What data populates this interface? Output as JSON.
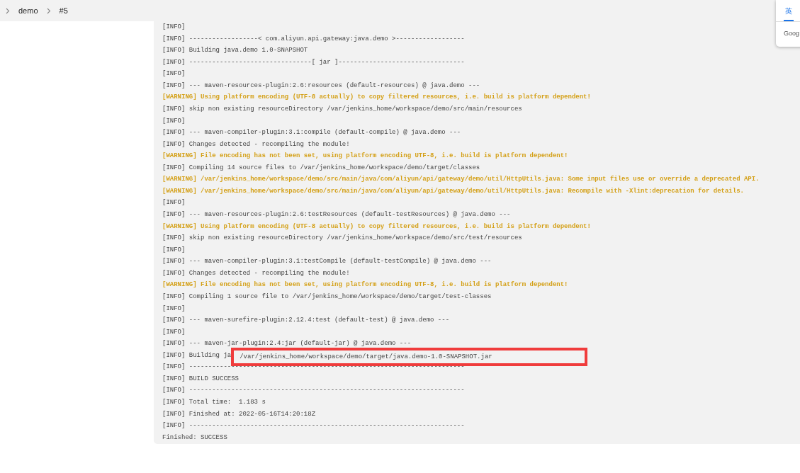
{
  "breadcrumb": [
    {
      "label": "demo"
    },
    {
      "label": "#5"
    }
  ],
  "console": {
    "lines": [
      {
        "kind": "info",
        "text": "[INFO]"
      },
      {
        "kind": "info",
        "text": "[INFO] ------------------< com.aliyun.api.gateway:java.demo >------------------"
      },
      {
        "kind": "info",
        "text": "[INFO] Building java.demo 1.0-SNAPSHOT"
      },
      {
        "kind": "info",
        "text": "[INFO] --------------------------------[ jar ]---------------------------------"
      },
      {
        "kind": "info",
        "text": "[INFO]"
      },
      {
        "kind": "info",
        "text": "[INFO] --- maven-resources-plugin:2.6:resources (default-resources) @ java.demo ---"
      },
      {
        "kind": "warning",
        "text": "[WARNING] Using platform encoding (UTF-8 actually) to copy filtered resources, i.e. build is platform dependent!"
      },
      {
        "kind": "info",
        "text": "[INFO] skip non existing resourceDirectory /var/jenkins_home/workspace/demo/src/main/resources"
      },
      {
        "kind": "info",
        "text": "[INFO]"
      },
      {
        "kind": "info",
        "text": "[INFO] --- maven-compiler-plugin:3.1:compile (default-compile) @ java.demo ---"
      },
      {
        "kind": "info",
        "text": "[INFO] Changes detected - recompiling the module!"
      },
      {
        "kind": "warning",
        "text": "[WARNING] File encoding has not been set, using platform encoding UTF-8, i.e. build is platform dependent!"
      },
      {
        "kind": "info",
        "text": "[INFO] Compiling 14 source files to /var/jenkins_home/workspace/demo/target/classes"
      },
      {
        "kind": "warning",
        "text": "[WARNING] /var/jenkins_home/workspace/demo/src/main/java/com/aliyun/api/gateway/demo/util/HttpUtils.java: Some input files use or override a deprecated API."
      },
      {
        "kind": "warning",
        "text": "[WARNING] /var/jenkins_home/workspace/demo/src/main/java/com/aliyun/api/gateway/demo/util/HttpUtils.java: Recompile with -Xlint:deprecation for details."
      },
      {
        "kind": "info",
        "text": "[INFO]"
      },
      {
        "kind": "info",
        "text": "[INFO] --- maven-resources-plugin:2.6:testResources (default-testResources) @ java.demo ---"
      },
      {
        "kind": "warning",
        "text": "[WARNING] Using platform encoding (UTF-8 actually) to copy filtered resources, i.e. build is platform dependent!"
      },
      {
        "kind": "info",
        "text": "[INFO] skip non existing resourceDirectory /var/jenkins_home/workspace/demo/src/test/resources"
      },
      {
        "kind": "info",
        "text": "[INFO]"
      },
      {
        "kind": "info",
        "text": "[INFO] --- maven-compiler-plugin:3.1:testCompile (default-testCompile) @ java.demo ---"
      },
      {
        "kind": "info",
        "text": "[INFO] Changes detected - recompiling the module!"
      },
      {
        "kind": "warning",
        "text": "[WARNING] File encoding has not been set, using platform encoding UTF-8, i.e. build is platform dependent!"
      },
      {
        "kind": "info",
        "text": "[INFO] Compiling 1 source file to /var/jenkins_home/workspace/demo/target/test-classes"
      },
      {
        "kind": "info",
        "text": "[INFO]"
      },
      {
        "kind": "info",
        "text": "[INFO] --- maven-surefire-plugin:2.12.4:test (default-test) @ java.demo ---"
      },
      {
        "kind": "info",
        "text": "[INFO]"
      },
      {
        "kind": "info",
        "text": "[INFO] --- maven-jar-plugin:2.4:jar (default-jar) @ java.demo ---"
      },
      {
        "kind": "highlight",
        "text": "[INFO] Building ja",
        "highlighted": "/var/jenkins_home/workspace/demo/target/java.demo-1.0-SNAPSHOT.jar"
      },
      {
        "kind": "info",
        "text": "[INFO] ------------------------------------------------------------------------"
      },
      {
        "kind": "info",
        "text": "[INFO] BUILD SUCCESS"
      },
      {
        "kind": "info",
        "text": "[INFO] ------------------------------------------------------------------------"
      },
      {
        "kind": "info",
        "text": "[INFO] Total time:  1.183 s"
      },
      {
        "kind": "info",
        "text": "[INFO] Finished at: 2022-05-16T14:20:18Z"
      },
      {
        "kind": "info",
        "text": "[INFO] ------------------------------------------------------------------------"
      },
      {
        "kind": "info",
        "text": "Finished: SUCCESS"
      }
    ]
  },
  "popup": {
    "tabs": [
      {
        "label": "英",
        "selected": true
      }
    ],
    "footer": "Goog"
  }
}
